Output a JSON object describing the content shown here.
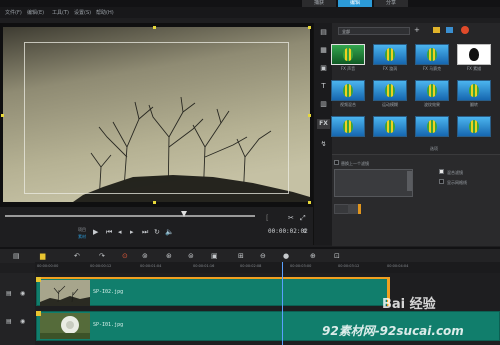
{
  "menu": {
    "items": [
      "文件(F)",
      "编辑(E)",
      "工具(T)",
      "设置(S)",
      "帮助(H)"
    ],
    "tabs": [
      "捕获",
      "编辑",
      "分享"
    ],
    "active_tab": "编辑"
  },
  "preview": {
    "project_label": "项目",
    "clip_label": "素材",
    "timecode": "00:00:02:02"
  },
  "library": {
    "category": "全部",
    "thumbnails": [
      {
        "label": "FX 声音",
        "kind": "green"
      },
      {
        "label": "FX 漩涡",
        "kind": "blue"
      },
      {
        "label": "FX 马赛克",
        "kind": "blue"
      },
      {
        "label": "FX 素描",
        "kind": "white"
      },
      {
        "label": "视频混合",
        "kind": "blue"
      },
      {
        "label": "运动模糊",
        "kind": "blue"
      },
      {
        "label": "波纹效果",
        "kind": "blue"
      },
      {
        "label": "翻转",
        "kind": "blue"
      },
      {
        "label": "",
        "kind": "blue"
      },
      {
        "label": "",
        "kind": "blue"
      },
      {
        "label": "",
        "kind": "blue"
      },
      {
        "label": "",
        "kind": "blue"
      }
    ],
    "options_title": "选项",
    "replace_last": "替换上一个滤镜",
    "option_a": "混合滤镜",
    "option_b": "显示网格线"
  },
  "timeline": {
    "ticks": [
      "00:00:00:00",
      "00:00:00:12",
      "00:00:01:04",
      "00:00:01:16",
      "00:00:02:08",
      "00:00:03:00",
      "00:00:03:12",
      "00:00:04:04"
    ],
    "clips": [
      {
        "name": "SP-I02.jpg"
      },
      {
        "name": "SP-I01.jpg"
      }
    ]
  },
  "watermark": {
    "line1": "Bai 经验",
    "line2": "92素材网-92sucai.com"
  },
  "colors": {
    "accent": "#2c9bd8",
    "clip": "#117e6c",
    "handle": "#e8d93a"
  }
}
